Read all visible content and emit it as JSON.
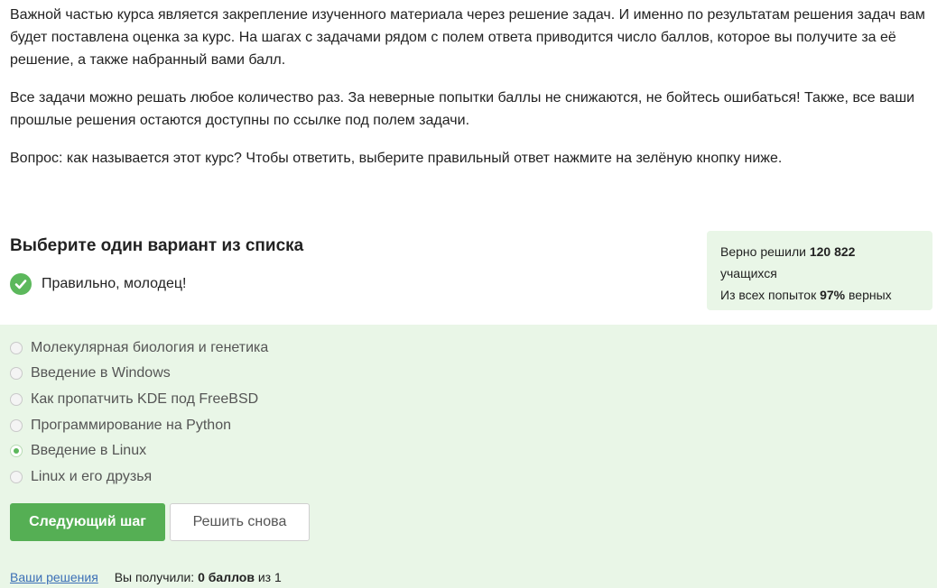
{
  "lesson": {
    "paragraphs": [
      "Важной частью курса является закрепление изученного материала через решение задач. И именно по результатам решения задач вам будет поставлена оценка за курс. На шагах с задачами рядом с полем ответа приводится число баллов, которое вы получите за её решение, а также набранный вами балл.",
      "Все задачи можно решать любое количество раз. За неверные попытки баллы не снижаются, не бойтесь ошибаться! Также, все ваши прошлые решения остаются доступны по ссылке под полем задачи.",
      "Вопрос: как называется этот курс? Чтобы ответить, выберите правильный ответ нажмите на зелёную кнопку ниже."
    ]
  },
  "quiz": {
    "title": "Выберите один вариант из списка",
    "result_text": "Правильно, молодец!",
    "options": [
      {
        "label": "Молекулярная биология и генетика",
        "checked": false
      },
      {
        "label": "Введение в Windows",
        "checked": false
      },
      {
        "label": "Как пропатчить KDE под FreeBSD",
        "checked": false
      },
      {
        "label": "Программирование на Python",
        "checked": false
      },
      {
        "label": "Введение в Linux",
        "checked": true
      },
      {
        "label": "Linux и его друзья",
        "checked": false
      }
    ],
    "next_button": "Следующий шаг",
    "retry_button": "Решить снова"
  },
  "stats": {
    "solved_prefix": "Верно решили",
    "solved_count": "120 822",
    "solved_suffix": "учащихся",
    "attempts_prefix": "Из всех попыток",
    "attempts_percent": "97%",
    "attempts_suffix": "верных"
  },
  "footer": {
    "solutions_link": "Ваши решения",
    "score_prefix": "Вы получили:",
    "score_value": "0 баллов",
    "score_suffix": "из 1"
  },
  "colors": {
    "accent_green": "#55af54",
    "panel_bg": "#e9f6e7"
  },
  "icons": {
    "result": "check-circle-icon"
  }
}
